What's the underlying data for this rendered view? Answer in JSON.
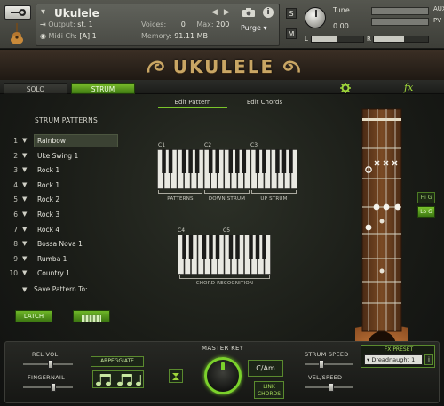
{
  "header": {
    "instrument_name": "Ukulele",
    "output_label": "Output:",
    "output_value": "st. 1",
    "midi_label": "Midi Ch:",
    "midi_value": "[A]  1",
    "voices_label": "Voices:",
    "voices_value": "0",
    "max_label": "Max:",
    "max_value": "200",
    "memory_label": "Memory:",
    "memory_value": "91.11 MB",
    "purge_label": "Purge",
    "s_label": "S",
    "m_label": "M",
    "tune_label": "Tune",
    "tune_value": "0.00",
    "pan_left": "L",
    "pan_right": "R",
    "aux_label": "AUX",
    "pv_label": "PV",
    "volume_level": 0.55,
    "pan_level": 0.5
  },
  "logo": {
    "text": "UKULELE"
  },
  "tabs": {
    "solo": "SOLO",
    "strum": "STRUM",
    "fx": "fx"
  },
  "sub_tabs": {
    "edit_pattern": "Edit Pattern",
    "edit_chords": "Edit Chords"
  },
  "strum_patterns": {
    "title": "STRUM PATTERNS",
    "items": [
      {
        "num": "1",
        "name": "Rainbow"
      },
      {
        "num": "2",
        "name": "Uke Swing 1"
      },
      {
        "num": "3",
        "name": "Rock 1"
      },
      {
        "num": "4",
        "name": "Rock 1"
      },
      {
        "num": "5",
        "name": "Rock 2"
      },
      {
        "num": "6",
        "name": "Rock 3"
      },
      {
        "num": "7",
        "name": "Rock 4"
      },
      {
        "num": "8",
        "name": "Bossa Nova 1"
      },
      {
        "num": "9",
        "name": "Rumba 1"
      },
      {
        "num": "10",
        "name": "Country 1"
      }
    ],
    "save_label": "Save Pattern To:"
  },
  "buttons": {
    "latch": "LATCH",
    "hi_g": "Hi G",
    "lo_g": "Lo G"
  },
  "keyboard1": {
    "labels": {
      "c1": "C1",
      "c2": "C2",
      "c3": "C3"
    },
    "captions": {
      "patterns": "PATTERNS",
      "down_strum": "DOWN STRUM",
      "up_strum": "UP STRUM"
    }
  },
  "keyboard2": {
    "labels": {
      "c4": "C4",
      "c5": "C5"
    },
    "caption": "CHORD RECOGNITION"
  },
  "controls": {
    "rel_vol": "REL VOL",
    "fingernail": "FINGERNAIL",
    "arpeggiate": "ARPEGGIATE",
    "master_key": "MASTER KEY",
    "key_value": "C/Am",
    "link_chords_line1": "LINK",
    "link_chords_line2": "CHORDS",
    "strum_speed": "STRUM SPEED",
    "vel_speed": "VEL/SPEED",
    "fx_preset_label": "FX PRESET",
    "fx_preset_value": "Dreadnaught 1",
    "fx_info": "i",
    "rel_vol_level": 0.55,
    "fingernail_level": 0.6,
    "strum_speed_level": 0.35,
    "vel_speed_level": 0.55
  }
}
